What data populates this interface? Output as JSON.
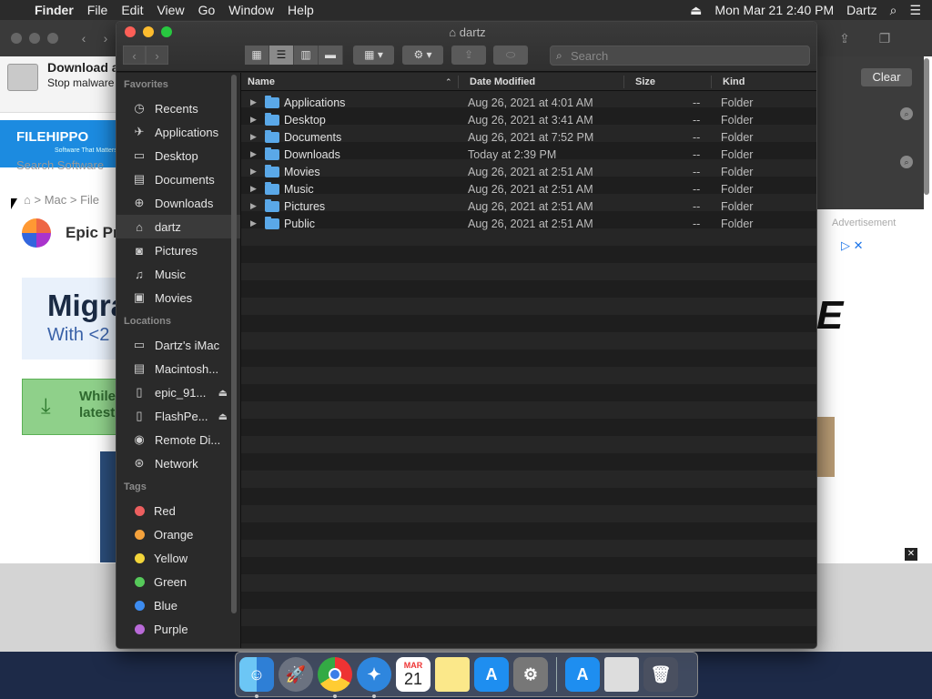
{
  "menubar": {
    "app": "Finder",
    "items": [
      "File",
      "Edit",
      "View",
      "Go",
      "Window",
      "Help"
    ],
    "clock": "Mon Mar 21  2:40 PM",
    "user": "Dartz"
  },
  "browser": {
    "notification_title": "Download a",
    "notification_text": "Stop malware",
    "logo_text": "FILEHIPPO",
    "logo_tagline": "Software That Matters",
    "search_placeholder": "Search Software",
    "breadcrumb": "> Mac > File",
    "app_name": "Epic Pr",
    "banner_big": "Migra",
    "banner_small": "With <2",
    "download_text": "While latest",
    "clear_button": "Clear",
    "advertisement_label": "Advertisement",
    "ad_text": "E"
  },
  "finder": {
    "title": "dartz",
    "search_placeholder": "Search",
    "columns": {
      "name": "Name",
      "date": "Date Modified",
      "size": "Size",
      "kind": "Kind"
    },
    "files": [
      {
        "name": "Applications",
        "date": "Aug 26, 2021 at 4:01 AM",
        "size": "--",
        "kind": "Folder"
      },
      {
        "name": "Desktop",
        "date": "Aug 26, 2021 at 3:41 AM",
        "size": "--",
        "kind": "Folder"
      },
      {
        "name": "Documents",
        "date": "Aug 26, 2021 at 7:52 PM",
        "size": "--",
        "kind": "Folder"
      },
      {
        "name": "Downloads",
        "date": "Today at 2:39 PM",
        "size": "--",
        "kind": "Folder"
      },
      {
        "name": "Movies",
        "date": "Aug 26, 2021 at 2:51 AM",
        "size": "--",
        "kind": "Folder"
      },
      {
        "name": "Music",
        "date": "Aug 26, 2021 at 2:51 AM",
        "size": "--",
        "kind": "Folder"
      },
      {
        "name": "Pictures",
        "date": "Aug 26, 2021 at 2:51 AM",
        "size": "--",
        "kind": "Folder"
      },
      {
        "name": "Public",
        "date": "Aug 26, 2021 at 2:51 AM",
        "size": "--",
        "kind": "Folder"
      }
    ]
  },
  "sidebar": {
    "favorites_header": "Favorites",
    "favorites": [
      {
        "label": "Recents",
        "icon": "clock-icon"
      },
      {
        "label": "Applications",
        "icon": "applications-icon"
      },
      {
        "label": "Desktop",
        "icon": "desktop-icon"
      },
      {
        "label": "Documents",
        "icon": "document-icon"
      },
      {
        "label": "Downloads",
        "icon": "download-icon"
      },
      {
        "label": "dartz",
        "icon": "home-icon"
      },
      {
        "label": "Pictures",
        "icon": "camera-icon"
      },
      {
        "label": "Music",
        "icon": "music-icon"
      },
      {
        "label": "Movies",
        "icon": "film-icon"
      }
    ],
    "locations_header": "Locations",
    "locations": [
      {
        "label": "Dartz's iMac",
        "icon": "imac-icon"
      },
      {
        "label": "Macintosh...",
        "icon": "drive-icon"
      },
      {
        "label": "epic_91...",
        "icon": "disk-icon"
      },
      {
        "label": "FlashPe...",
        "icon": "disk-icon"
      },
      {
        "label": "Remote Di...",
        "icon": "optical-disc-icon"
      },
      {
        "label": "Network",
        "icon": "globe-icon"
      }
    ],
    "tags_header": "Tags",
    "tags": [
      {
        "label": "Red",
        "color": "#ec5f5f"
      },
      {
        "label": "Orange",
        "color": "#f5a23c"
      },
      {
        "label": "Yellow",
        "color": "#f2d53a"
      },
      {
        "label": "Green",
        "color": "#56c95a"
      },
      {
        "label": "Blue",
        "color": "#3d8cf0"
      },
      {
        "label": "Purple",
        "color": "#b96ad8"
      }
    ]
  },
  "dock": {
    "calendar_month": "MAR",
    "calendar_day": "21"
  }
}
